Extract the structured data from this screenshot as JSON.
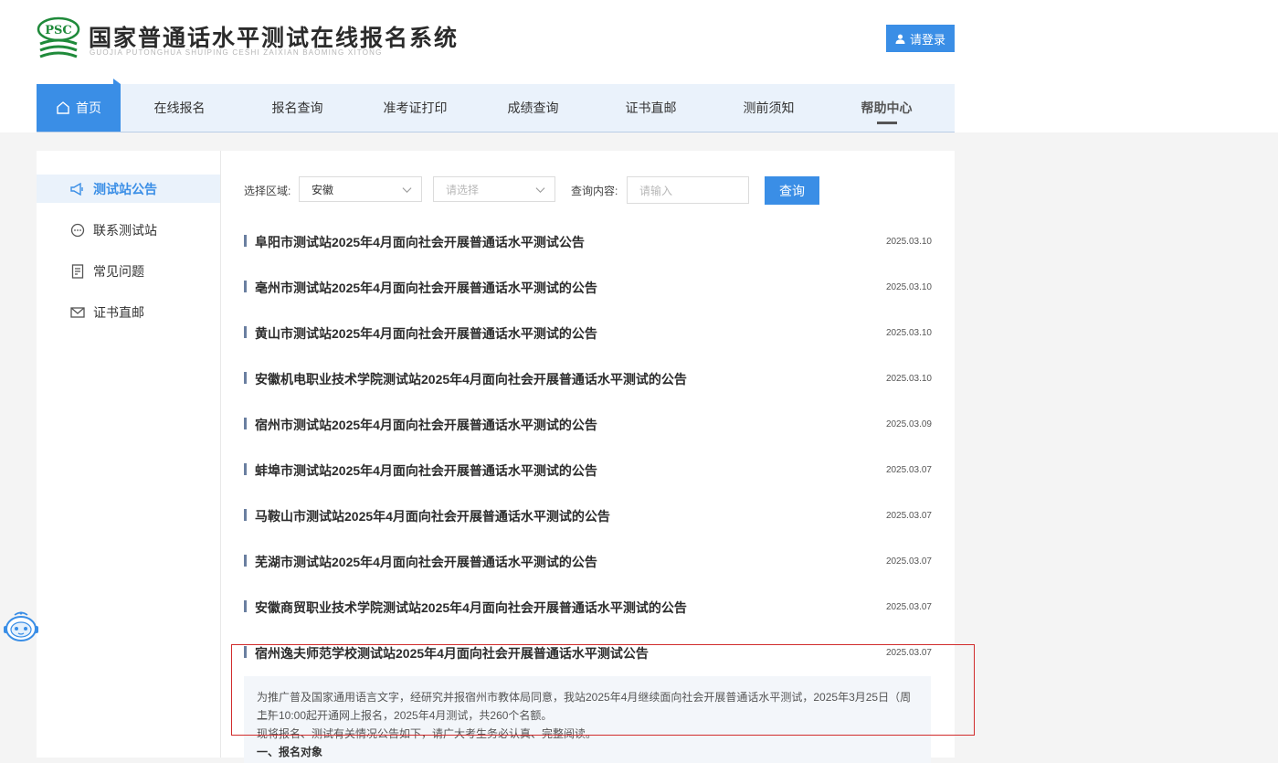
{
  "header": {
    "logo_text": "PSC",
    "title": "国家普通话水平测试在线报名系统",
    "subtitle": "GUOJIA PUTONGHUA SHUIPING CESHI ZAIXIAN BAOMING XITONG",
    "login_label": "请登录"
  },
  "nav": [
    {
      "label": "首页"
    },
    {
      "label": "在线报名"
    },
    {
      "label": "报名查询"
    },
    {
      "label": "准考证打印"
    },
    {
      "label": "成绩查询"
    },
    {
      "label": "证书直邮"
    },
    {
      "label": "测前须知"
    },
    {
      "label": "帮助中心"
    }
  ],
  "sidebar": [
    {
      "label": "测试站公告",
      "icon": "megaphone-icon"
    },
    {
      "label": "联系测试站",
      "icon": "chat-icon"
    },
    {
      "label": "常见问题",
      "icon": "document-icon"
    },
    {
      "label": "证书直邮",
      "icon": "mail-icon"
    }
  ],
  "filter": {
    "region_label": "选择区域:",
    "region_value": "安徽",
    "sub_placeholder": "请选择",
    "content_label": "查询内容:",
    "content_placeholder": "请输入",
    "query_label": "查询"
  },
  "announcements": [
    {
      "title": "阜阳市测试站2025年4月面向社会开展普通话水平测试公告",
      "date": "2025.03.10"
    },
    {
      "title": "亳州市测试站2025年4月面向社会开展普通话水平测试的公告",
      "date": "2025.03.10"
    },
    {
      "title": "黄山市测试站2025年4月面向社会开展普通话水平测试的公告",
      "date": "2025.03.10"
    },
    {
      "title": "安徽机电职业技术学院测试站2025年4月面向社会开展普通话水平测试的公告",
      "date": "2025.03.10"
    },
    {
      "title": "宿州市测试站2025年4月面向社会开展普通话水平测试的公告",
      "date": "2025.03.09"
    },
    {
      "title": "蚌埠市测试站2025年4月面向社会开展普通话水平测试的公告",
      "date": "2025.03.07"
    },
    {
      "title": "马鞍山市测试站2025年4月面向社会开展普通话水平测试的公告",
      "date": "2025.03.07"
    },
    {
      "title": "芜湖市测试站2025年4月面向社会开展普通话水平测试的公告",
      "date": "2025.03.07"
    },
    {
      "title": "安徽商贸职业技术学院测试站2025年4月面向社会开展普通话水平测试的公告",
      "date": "2025.03.07"
    },
    {
      "title": "宿州逸夫师范学校测试站2025年4月面向社会开展普通话水平测试公告",
      "date": "2025.03.07"
    }
  ],
  "expanded": {
    "line1": "为推广普及国家通用语言文字，经研究并报宿州市教体局同意，我站2025年4月继续面向社会开展普通话水平测试，2025年3月25日（周二）",
    "line2": "上午10:00起开通网上报名，2025年4月测试，共260个名额。",
    "line3": "现将报名、测试有关情况公告如下，请广大考生务必认真、完整阅读。",
    "line4": "一、报名对象"
  },
  "colors": {
    "accent": "#3a8ee6",
    "highlight": "#d12c2c"
  }
}
